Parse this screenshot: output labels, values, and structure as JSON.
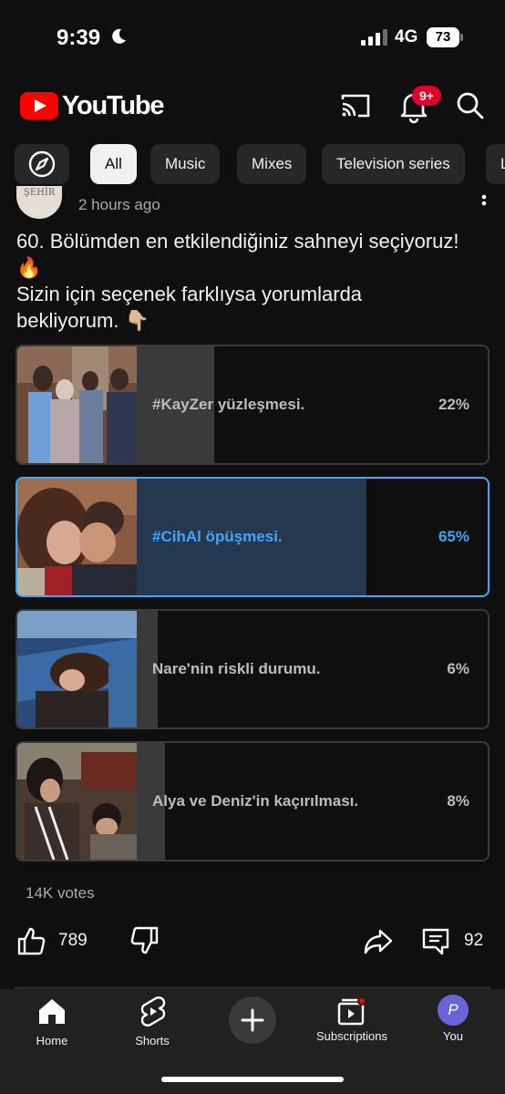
{
  "status_bar": {
    "time": "9:39",
    "network": "4G",
    "battery": "73"
  },
  "header": {
    "logo_text": "YouTube",
    "notification_badge": "9+"
  },
  "chips": [
    "All",
    "Music",
    "Mixes",
    "Television series",
    "L"
  ],
  "post": {
    "avatar_text": "ŞEHİR",
    "time": "2 hours ago",
    "text_line1": "60. Bölümden en etkilendiğiniz sahneyi seçiyoruz!",
    "text_line2": "🔥",
    "text_line3": "Sizin için seçenek farklıysa yorumlarda",
    "text_line4": "bekliyorum. 👇🏼"
  },
  "poll": {
    "options": [
      {
        "label": "#KayZer yüzleşmesi.",
        "percent_text": "22%",
        "percent": 22,
        "selected": false
      },
      {
        "label": "#CihAl öpüşmesi.",
        "percent_text": "65%",
        "percent": 65,
        "selected": true
      },
      {
        "label": "Nare'nin riskli durumu.",
        "percent_text": "6%",
        "percent": 6,
        "selected": false
      },
      {
        "label": "Alya ve Deniz'in kaçırılması.",
        "percent_text": "8%",
        "percent": 8,
        "selected": false
      }
    ],
    "votes": "14K votes"
  },
  "actions": {
    "likes": "789",
    "comments": "92"
  },
  "bottom_nav": {
    "home": "Home",
    "shorts": "Shorts",
    "subscriptions": "Subscriptions",
    "you": "You",
    "you_initial": "P"
  },
  "colors": {
    "accent": "#3ea6ff",
    "brand": "#ff0000",
    "background": "#0f0f0f"
  }
}
